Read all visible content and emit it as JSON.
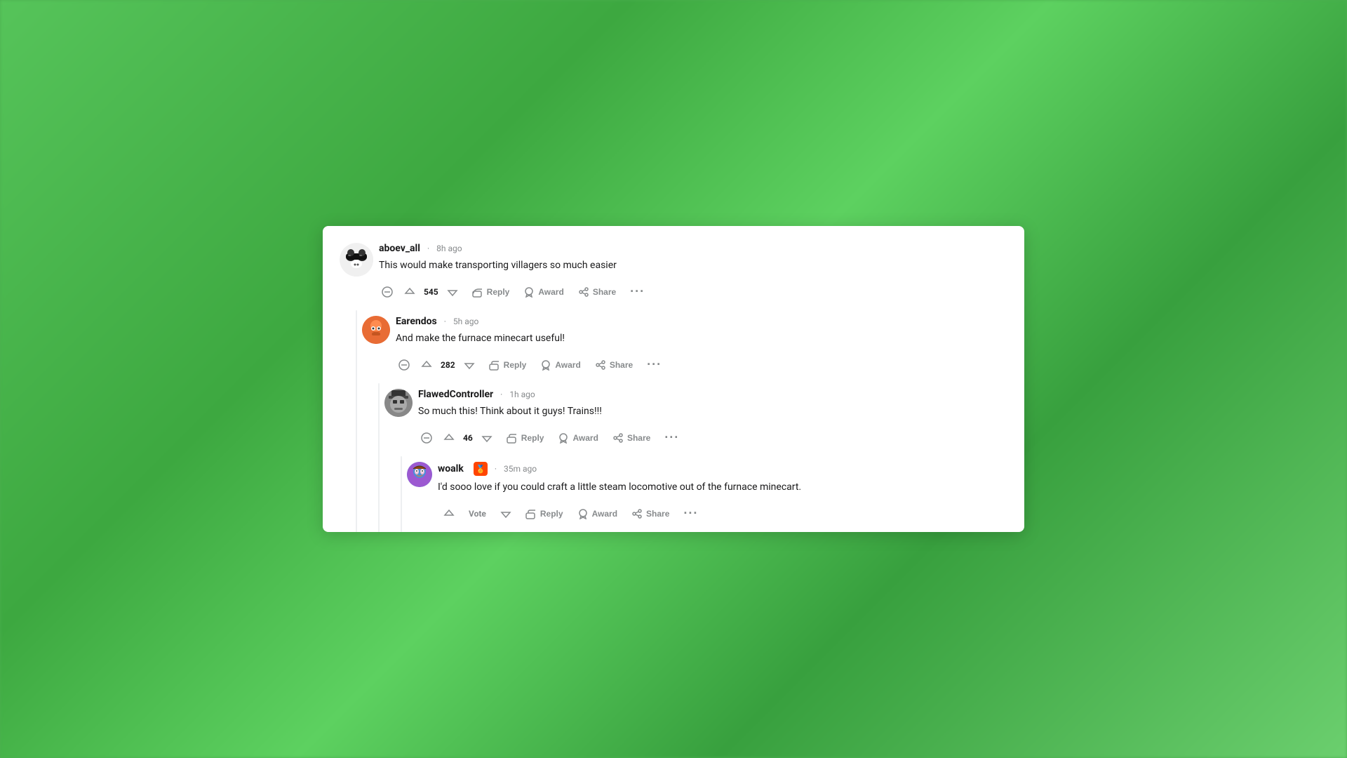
{
  "background": "#4caf50",
  "comments": [
    {
      "id": "aboev",
      "username": "aboev_all",
      "timestamp": "8h ago",
      "body": "This would make transporting villagers so much easier",
      "votes": 545,
      "level": 0,
      "avatarLabel": "A",
      "actions": {
        "reply": "Reply",
        "award": "Award",
        "share": "Share"
      }
    },
    {
      "id": "earendos",
      "username": "Earendos",
      "timestamp": "5h ago",
      "body": "And make the furnace minecart useful!",
      "votes": 282,
      "level": 1,
      "avatarLabel": "E",
      "actions": {
        "reply": "Reply",
        "award": "Award",
        "share": "Share"
      }
    },
    {
      "id": "flawed",
      "username": "FlawedController",
      "timestamp": "1h ago",
      "body": "So much this! Think about it guys! Trains!!!",
      "votes": 46,
      "level": 2,
      "avatarLabel": "F",
      "actions": {
        "reply": "Reply",
        "award": "Award",
        "share": "Share"
      }
    },
    {
      "id": "woalk",
      "username": "woalk",
      "timestamp": "35m ago",
      "body": "I'd sooo love if you could craft a little steam locomotive out of the furnace minecart.",
      "votes": null,
      "level": 3,
      "avatarLabel": "W",
      "actions": {
        "vote": "Vote",
        "reply": "Reply",
        "award": "Award",
        "share": "Share"
      }
    }
  ],
  "labels": {
    "reply": "Reply",
    "award": "Award",
    "share": "Share",
    "vote": "Vote",
    "more": "···"
  }
}
